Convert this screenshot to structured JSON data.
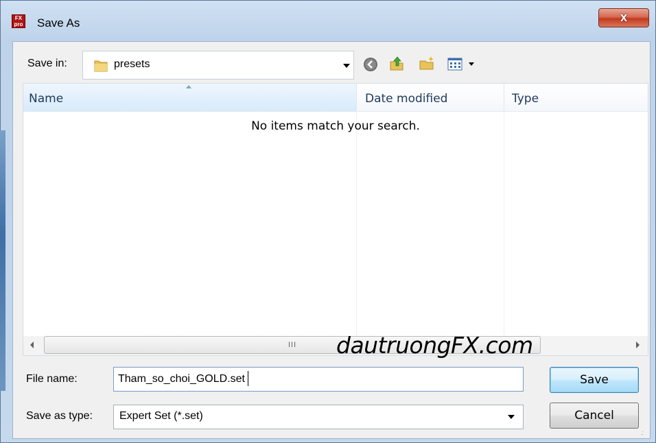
{
  "window": {
    "title": "Save As",
    "close_label": "x",
    "app_icon_text": "FX pro"
  },
  "toolbar": {
    "save_in_label": "Save in:",
    "save_in_value": "presets",
    "icons": [
      "back-icon",
      "up-folder-icon",
      "new-folder-icon",
      "view-menu-icon"
    ]
  },
  "list": {
    "columns": [
      {
        "label": "Name",
        "sorted": true
      },
      {
        "label": "Date modified"
      },
      {
        "label": "Type"
      }
    ],
    "empty_message": "No items match your search.",
    "scroll_grip": "III"
  },
  "watermark": "dautruongFX.com",
  "form": {
    "file_name_label": "File name:",
    "file_name_value": "Tham_so_choi_GOLD.set",
    "save_as_type_label": "Save as type:",
    "save_as_type_value": "Expert Set (*.set)"
  },
  "buttons": {
    "save": "Save",
    "cancel": "Cancel"
  },
  "colors": {
    "accent": "#3c7fb1",
    "close_red": "#c23b1f"
  }
}
